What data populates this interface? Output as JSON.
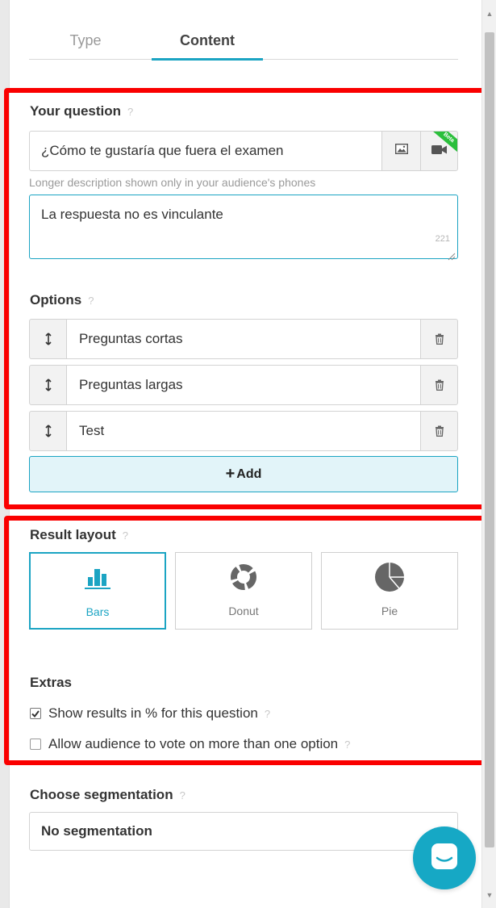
{
  "tabs": {
    "type_label": "Type",
    "content_label": "Content",
    "active": "Content"
  },
  "question": {
    "title": "Your question",
    "help": "?",
    "value": "¿Cómo te gustaría que fuera el examen",
    "image_icon": "image-icon",
    "video_icon": "video-camera-icon",
    "beta_label": "Beta"
  },
  "description": {
    "label": "Longer description shown only in your audience's phones",
    "value": "La respuesta no es vinculante",
    "counter": "221"
  },
  "options": {
    "title": "Options",
    "help": "?",
    "items": [
      {
        "label": "Preguntas cortas"
      },
      {
        "label": "Preguntas largas"
      },
      {
        "label": "Test"
      }
    ],
    "add_label": "Add"
  },
  "result_layout": {
    "title": "Result layout",
    "help": "?",
    "choices": [
      {
        "label": "Bars",
        "selected": true
      },
      {
        "label": "Donut",
        "selected": false
      },
      {
        "label": "Pie",
        "selected": false
      }
    ]
  },
  "extras": {
    "title": "Extras",
    "items": [
      {
        "label": "Show results in % for this question",
        "checked": true,
        "help": "?"
      },
      {
        "label": "Allow audience to vote on more than one option",
        "checked": false,
        "help": "?"
      }
    ]
  },
  "segmentation": {
    "title": "Choose segmentation",
    "help": "?",
    "value": "No segmentation"
  },
  "colors": {
    "accent": "#1ba4c3",
    "annotation_red": "#fa0000",
    "beta_green": "#2bbf3c"
  }
}
